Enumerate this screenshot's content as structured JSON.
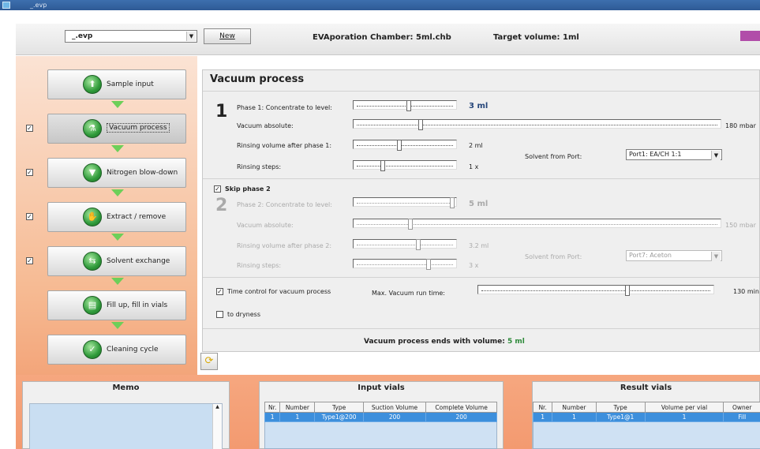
{
  "window": {
    "title": "_.evp"
  },
  "toolbar": {
    "file": "_.evp",
    "new_label": "New",
    "chamber": "EVAporation Chamber: 5ml.chb",
    "target": "Target volume: 1ml",
    "accent_color": "#b14da9"
  },
  "sidebar": {
    "steps": [
      {
        "label": "Sample input",
        "checkbox": null
      },
      {
        "label": "Vacuum process",
        "checkbox": true,
        "active": true
      },
      {
        "label": "Nitrogen blow-down",
        "checkbox": true
      },
      {
        "label": "Extract / remove",
        "checkbox": true
      },
      {
        "label": "Solvent exchange",
        "checkbox": true
      },
      {
        "label": "Fill up, fill in vials",
        "checkbox": null
      },
      {
        "label": "Cleaning cycle",
        "checkbox": null
      }
    ]
  },
  "main": {
    "title": "Vacuum process",
    "phase1": {
      "num": "1",
      "concentrate_label": "Phase 1: Concentrate to level:",
      "concentrate_value": "3 ml",
      "concentrate_level": 0.55,
      "vacuum_label": "Vacuum absolute:",
      "vacuum_value": "180 mbar",
      "vacuum_level": 0.18,
      "rinse_label": "Rinsing volume after phase 1:",
      "rinse_value": "2 ml",
      "rinse_level": 0.45,
      "steps_label": "Rinsing steps:",
      "steps_value": "1 x",
      "steps_level": 0.28,
      "solvent_label": "Solvent from Port:",
      "solvent_value": "Port1: EA/CH 1:1"
    },
    "skip_label": "Skip phase 2",
    "phase2": {
      "num": "2",
      "concentrate_label": "Phase 2: Concentrate to level:",
      "concentrate_value": "5 ml",
      "concentrate_level": 1.0,
      "vacuum_label": "Vacuum absolute:",
      "vacuum_value": "150 mbar",
      "vacuum_level": 0.15,
      "rinse_label": "Rinsing volume after phase 2:",
      "rinse_value": "3.2 ml",
      "rinse_level": 0.65,
      "steps_label": "Rinsing steps:",
      "steps_value": "3 x",
      "steps_level": 0.75,
      "solvent_label": "Solvent from Port:",
      "solvent_value": "Port7: Aceton"
    },
    "time_control_label": "Time control for vacuum process",
    "max_time_label": "Max. Vacuum run time:",
    "max_time_value": "130 min",
    "max_time_level": 0.64,
    "dryness_label": "to dryness",
    "ends_prefix": "Vacuum process ends with volume:",
    "ends_value": "5 ml"
  },
  "memo": {
    "title": "Memo"
  },
  "input_vials": {
    "title": "Input vials",
    "columns": [
      "Nr.",
      "Number",
      "Type",
      "Suction Volume",
      "Complete Volume"
    ],
    "rows": [
      [
        "1",
        "1",
        "Type1@200",
        "200",
        "200"
      ]
    ]
  },
  "result_vials": {
    "title": "Result vials",
    "columns": [
      "Nr.",
      "Number",
      "Type",
      "Volume per vial",
      "Owner"
    ],
    "rows": [
      [
        "1",
        "1",
        "Type1@1",
        "1",
        "Fill"
      ]
    ]
  }
}
